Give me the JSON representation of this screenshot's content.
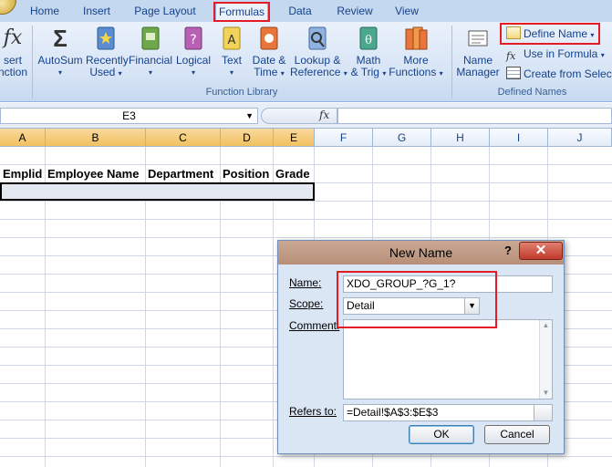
{
  "tabs": [
    "Home",
    "Insert",
    "Page Layout",
    "Formulas",
    "Data",
    "Review",
    "View"
  ],
  "active_tab": "Formulas",
  "ribbon": {
    "insert_function": [
      "sert",
      "nction"
    ],
    "function_library": {
      "label": "Function Library",
      "buttons": [
        {
          "l1": "AutoSum",
          "l2": ""
        },
        {
          "l1": "Recently",
          "l2": "Used"
        },
        {
          "l1": "Financial",
          "l2": ""
        },
        {
          "l1": "Logical",
          "l2": ""
        },
        {
          "l1": "Text",
          "l2": ""
        },
        {
          "l1": "Date &",
          "l2": "Time"
        },
        {
          "l1": "Lookup &",
          "l2": "Reference"
        },
        {
          "l1": "Math",
          "l2": "& Trig"
        },
        {
          "l1": "More",
          "l2": "Functions"
        }
      ]
    },
    "defined_names": {
      "label": "Defined Names",
      "name_manager": [
        "Name",
        "Manager"
      ],
      "define_name": "Define Name",
      "use_in_formula": "Use in Formula",
      "create_from_selection": "Create from Selection"
    }
  },
  "formula_bar": {
    "name_box": "E3",
    "fx": "fx",
    "formula": ""
  },
  "columns": [
    "A",
    "B",
    "C",
    "D",
    "E",
    "F",
    "G",
    "H",
    "I",
    "J"
  ],
  "selected_columns": [
    "A",
    "B",
    "C",
    "D",
    "E"
  ],
  "header_row": [
    "Emplid",
    "Employee Name",
    "Department",
    "Position",
    "Grade"
  ],
  "dialog": {
    "title": "New Name",
    "help": "?",
    "name_label": "Name:",
    "name_value": "XDO_GROUP_?G_1?",
    "scope_label": "Scope:",
    "scope_value": "Detail",
    "comment_label": "Comment:",
    "refers_label": "Refers to:",
    "refers_value": "=Detail!$A$3:$E$3",
    "ok": "OK",
    "cancel": "Cancel"
  },
  "colors": {
    "highlight_red": "#e31c25",
    "selected_header": "#f1c15f"
  }
}
